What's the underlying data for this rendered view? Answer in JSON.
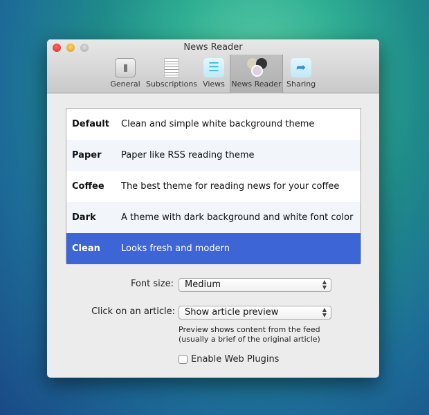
{
  "window": {
    "title": "News Reader"
  },
  "toolbar": [
    {
      "label": "General",
      "icon": "light-switch-icon"
    },
    {
      "label": "Subscriptions",
      "icon": "document-list-icon"
    },
    {
      "label": "Views",
      "icon": "list-icon"
    },
    {
      "label": "News Reader",
      "icon": "theme-circles-icon",
      "selected": true
    },
    {
      "label": "Sharing",
      "icon": "share-icon"
    }
  ],
  "themes": [
    {
      "name": "Default",
      "desc": "Clean and simple white background theme"
    },
    {
      "name": "Paper",
      "desc": "Paper like RSS reading theme"
    },
    {
      "name": "Coffee",
      "desc": "The best theme for reading news for your coffee"
    },
    {
      "name": "Dark",
      "desc": "A theme with dark background and white font color"
    },
    {
      "name": "Clean",
      "desc": "Looks fresh and modern",
      "selected": true
    }
  ],
  "font_size": {
    "label": "Font size:",
    "value": "Medium"
  },
  "click_article": {
    "label": "Click on an article:",
    "value": "Show article preview",
    "help1": "Preview shows content from the feed",
    "help2": "(usually a brief of the original article)"
  },
  "plugins": {
    "label": "Enable Web Plugins",
    "checked": false
  },
  "colors": {
    "selection": "#3e65d6"
  }
}
